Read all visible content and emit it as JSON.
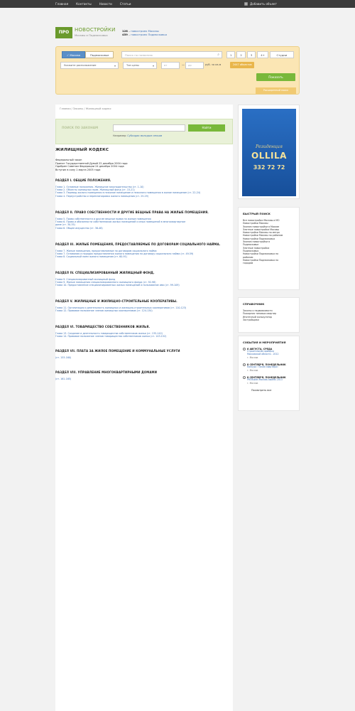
{
  "topnav": {
    "items": [
      "Главная",
      "Контакты",
      "Новости",
      "Статьи"
    ],
    "add_object": "Добавить объект"
  },
  "header": {
    "logo_short": "ПРО",
    "logo_title": "НОВОСТРОЙКИ",
    "logo_sub": "Москвы и Подмосковья",
    "counts": [
      {
        "num": "128",
        "text": "новостроек Москвы"
      },
      {
        "num": "459",
        "text": "новостроек Подмосковья"
      }
    ]
  },
  "search": {
    "region_tabs": [
      "Москва",
      "Подмосковье"
    ],
    "query_placeholder": "Поиск по названию",
    "rooms": [
      "1",
      "2",
      "3",
      "4+",
      "Студии"
    ],
    "location_select": "Укажите расположение",
    "price_type_select": "Тип цены",
    "price_from_placeholder": "от",
    "price_to_placeholder": "до",
    "price_unit": "руб. за кв.м",
    "found_badge": "2447 объектов",
    "show_button": "Показать",
    "extended_link": "Расширенный поиск"
  },
  "breadcrumbs": "Главная / Законы / Жилищный кодекс",
  "law_search": {
    "label": "ПОИСК ПО ЗАКОНАМ",
    "button": "Найти",
    "example_prefix": "Например:",
    "example_link": "Субсидии молодым семьям"
  },
  "document": {
    "title": "ЖИЛИЩНЫЙ КОДЕКС",
    "meta": [
      "Федеральный закон",
      "Принят Государственной Думой 22 декабря 2004 года",
      "Одобрен Советом Федерации 24 декабря 2004 года",
      "Вступил в силу 1 марта 2005 года"
    ],
    "sections": [
      {
        "title": "РАЗДЕЛ I. ОБЩИЕ ПОЛОЖЕНИЯ.",
        "chapters": [
          "Глава 1. Основные положения. Жилищное законодательство (ст. 1-10)",
          "Глава 2. Объекты жилищных прав. Жилищный фонд (ст. 15-21)",
          "Глава 3. Перевод жилого помещения в нежилое помещение и нежилого помещения в жилое помещение (ст. 22-24)",
          "Глава 4. Переустройство и перепланировка жилого помещения (ст. 25-29)"
        ]
      },
      {
        "title": "РАЗДЕЛ II. ПРАВО СОБСТВЕННОСТИ И ДРУГИЕ ВЕЩНЫЕ ПРАВА НА ЖИЛЫЕ ПОМЕЩЕНИЯ.",
        "chapters": [
          "Глава 5. Право собственности и другие вещные права на жилые помещения",
          "Глава 6. Права и обязанности собственников жилых помещений и иных помещений в многоквартирном",
          "доме (ст. 30-35)",
          "Глава 6. Общее имущество (ст. 36-48)"
        ]
      },
      {
        "title": "РАЗДЕЛ III. ЖИЛЫЕ ПОМЕЩЕНИЯ, ПРЕДОСТАВЛЯЕМЫЕ ПО ДОГОВОРАМ СОЦИАЛЬНОГО НАЙМА.",
        "chapters": [
          "Глава 7. Жилые помещения, предоставляемые по договорам социального найма",
          "Глава 7. Основания и порядок предоставления жилого помещения по договору социального найма (ст. 49-59)",
          "Глава 8. Социальный наем жилого помещения (ст. 60-91)"
        ]
      },
      {
        "title": "РАЗДЕЛ IV. СПЕЦИАЛИЗИРОВАННЫЙ ЖИЛИЩНЫЙ ФОНД.",
        "chapters": [
          "Глава 9. Специализированный жилищный фонд",
          "Глава 9. Жилые помещения специализированного жилищного фонда (ст. 92-98)",
          "Глава 10. Предоставление специализированных жилых помещений и пользование ими (ст. 99-109)"
        ]
      },
      {
        "title": "РАЗДЕЛ V. ЖИЛИЩНЫЕ И ЖИЛИЩНО-СТРОИТЕЛЬНЫЕ КООПЕРАТИВЫ.",
        "chapters": [
          "Глава 11. Организация и деятельность жилищных и жилищно-строительных кооперативов (ст. 110-123)",
          "Глава 12. Правовое положение членов жилищных кооперативов (ст. 124-134)"
        ]
      },
      {
        "title": "РАЗДЕЛ VI. ТОВАРИЩЕСТВО СОБСТВЕННИКОВ ЖИЛЬЯ.",
        "chapters": [
          "Глава 13. Создание и деятельность товарищества собственников жилья (ст. 135-142)",
          "Глава 14. Правовое положение членов товарищества собственников жилья (ст. 143-152)"
        ]
      },
      {
        "title": "РАЗДЕЛ VII. ПЛАТА ЗА ЖИЛОЕ ПОМЕЩЕНИЕ И КОММУНАЛЬНЫЕ УСЛУГИ",
        "chapters": [
          "(ст. 153-160)"
        ]
      },
      {
        "title": "РАЗДЕЛ VIII. УПРАВЛЕНИЕ МНОГОКВАРТИРНЫМИ ДОМАМИ",
        "chapters": [
          "(ст. 161-165)"
        ]
      }
    ]
  },
  "banner": {
    "line1": "Резиденция",
    "line2": "OLLILA",
    "line3": "332 72 72"
  },
  "quick_search": {
    "title": "БЫСТРЫЙ ПОИСК",
    "items": [
      "Все новостройки Москвы и МО",
      "Новостройки Москвы",
      "Эконом новостройки в Москве",
      "Элитные новостройки Москвы",
      "Новостройки Москвы по метро",
      "Новостройки Москвы по районам",
      "Новостройки Подмосковья",
      "Эконом новостройки в",
      "Подмосковье",
      "Элитные новостройки",
      "Подмосковья",
      "Новостройки Подмосковья по",
      "районам",
      "Новостройки Подмосковья по",
      "городам"
    ]
  },
  "reference": {
    "title": "СПРАВОЧНИК",
    "items": [
      "Законы о недвижимости",
      "Пожарная типовых квартир",
      "Ипотечный калькулятор",
      "Застройщики"
    ]
  },
  "events": {
    "title": "СОБЫТИЯ И МЕРОПРИЯТИЯ",
    "items": [
      {
        "date": "6 АВГУСТА, СРЕДА",
        "text": [
          "Строительная ярмарка",
          "Московской области - 2012"
        ],
        "place": "г. Москва"
      },
      {
        "date": "8 СЕНТЯБРЯ, ПОНЕДЕЛЬНИК",
        "text": [
          "Конкурс «Тихая квартира»"
        ],
        "place": "г. Москва"
      },
      {
        "date": "8 СЕНТЯБРЯ, ПОНЕДЕЛЬНИК",
        "text": [
          "PROBuilds Москва Awards 2013"
        ],
        "place": "г. Москва"
      }
    ],
    "all_link": "Посмотреть все"
  }
}
